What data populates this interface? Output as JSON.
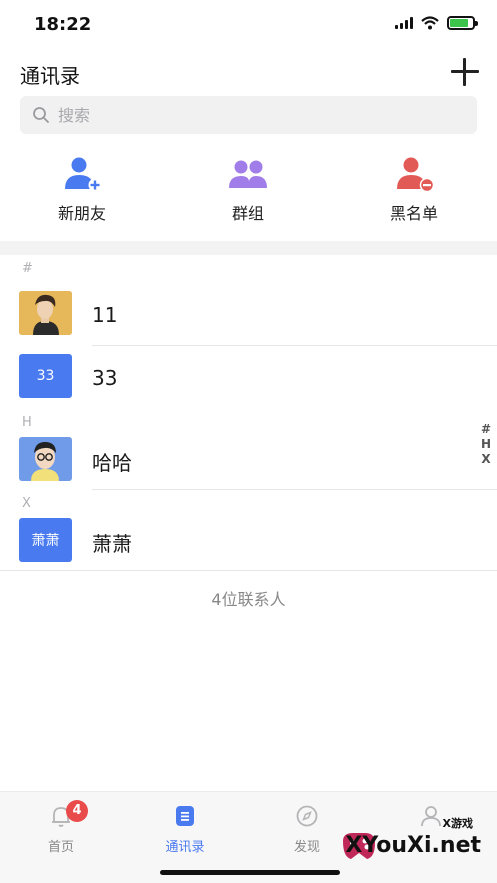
{
  "status_bar": {
    "time": "18:22"
  },
  "header": {
    "title": "通讯录"
  },
  "search": {
    "placeholder": "搜索"
  },
  "quick_actions": {
    "new_friends": "新朋友",
    "groups": "群组",
    "blacklist": "黑名单"
  },
  "contacts": {
    "groups": [
      {
        "letter": "#",
        "items": [
          {
            "name": "11",
            "avatar_text": ""
          },
          {
            "name": "33",
            "avatar_text": "33"
          }
        ]
      },
      {
        "letter": "H",
        "items": [
          {
            "name": "哈哈",
            "avatar_text": ""
          }
        ]
      },
      {
        "letter": "X",
        "items": [
          {
            "name": "萧萧",
            "avatar_text": "萧萧"
          }
        ]
      }
    ]
  },
  "index_bar": [
    "#",
    "H",
    "X"
  ],
  "footer": {
    "count_text": "4位联系人"
  },
  "tabbar": {
    "tabs": [
      {
        "label": "首页",
        "badge": "4"
      },
      {
        "label": "通讯录"
      },
      {
        "label": "发现"
      }
    ]
  },
  "watermark": {
    "small": "X游戏",
    "main": "XYouXi.net"
  },
  "colors": {
    "accent": "#4a7af0",
    "badge": "#e94b4b",
    "blacklist": "#e25a55",
    "groups": "#a07de8"
  }
}
